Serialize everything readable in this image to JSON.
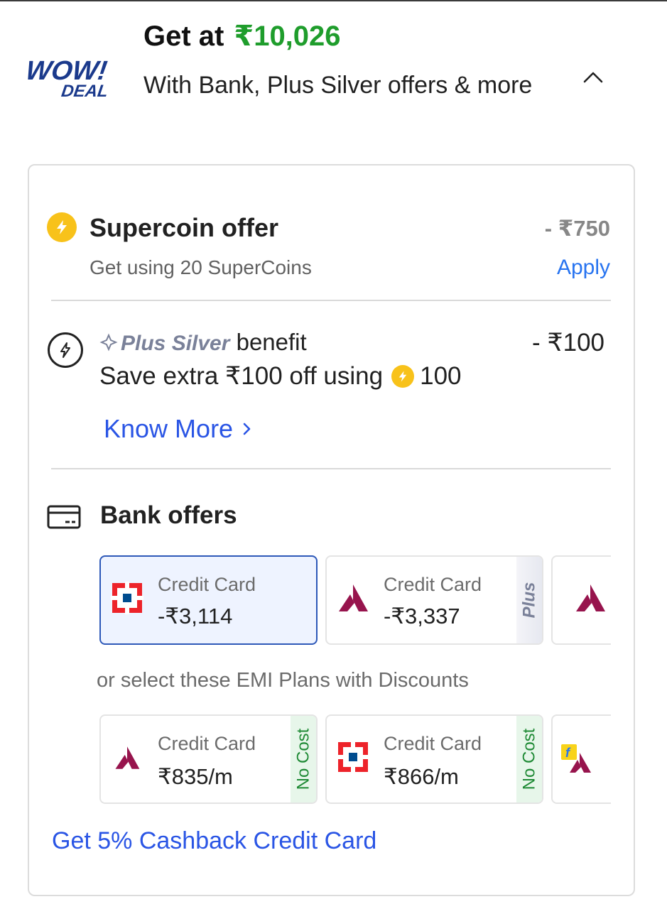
{
  "header": {
    "logo_text_line1": "WOW!",
    "logo_text_line2": "DEAL",
    "title_prefix": "Get at",
    "title_price": "₹10,026",
    "subtitle": "With Bank, Plus Silver offers & more"
  },
  "supercoin": {
    "title": "Supercoin offer",
    "amount": "- ₹750",
    "subtitle": "Get using 20 SuperCoins",
    "apply_label": "Apply"
  },
  "plus_silver": {
    "brand": "Plus Silver",
    "benefit_label": "benefit",
    "amount": "- ₹100",
    "line2_prefix": "Save extra ₹100 off using",
    "line2_coins": "100",
    "know_more_label": "Know More"
  },
  "bank_offers": {
    "title": "Bank offers",
    "cards": [
      {
        "label": "Credit Card",
        "value": "-₹3,114",
        "bank": "hdfc",
        "selected": true,
        "tag": ""
      },
      {
        "label": "Credit Card",
        "value": "-₹3,337",
        "bank": "axis",
        "selected": false,
        "tag": "Plus"
      }
    ],
    "emi_caption": "or select these EMI Plans with Discounts",
    "emi_cards": [
      {
        "label": "Credit Card",
        "value": "₹835/m",
        "bank": "axis",
        "tag": "No Cost"
      },
      {
        "label": "Credit Card",
        "value": "₹866/m",
        "bank": "hdfc",
        "tag": "No Cost"
      }
    ],
    "cashback_link": "Get 5% Cashback Credit Card"
  },
  "colors": {
    "price_green": "#1f9d2c",
    "link_blue": "#2a55e5",
    "apply_blue": "#2874f0",
    "selected_border": "#2d58b8",
    "coin_yellow": "#f8c21a",
    "axis_maroon": "#97144d",
    "hdfc_red": "#ed232a",
    "hdfc_blue": "#004c8f"
  },
  "icons": {
    "collapse": "chevron-up-icon",
    "supercoin": "supercoin-icon",
    "plus_silver": "lightning-circle-icon",
    "bank": "card-icon",
    "know_more": "chevron-right-icon"
  }
}
